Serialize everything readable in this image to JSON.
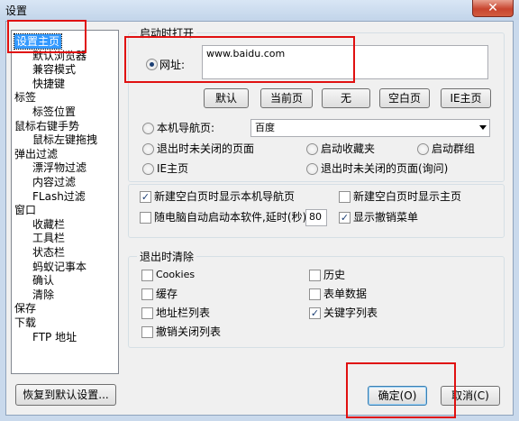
{
  "window": {
    "title": "设置",
    "close_glyph": "✕"
  },
  "tree": [
    {
      "label": "设置主页",
      "level": 0,
      "selected": true
    },
    {
      "label": "默认浏览器",
      "level": 1
    },
    {
      "label": "兼容模式",
      "level": 1
    },
    {
      "label": "快捷键",
      "level": 1
    },
    {
      "label": "标签",
      "level": 0
    },
    {
      "label": "标签位置",
      "level": 1
    },
    {
      "label": "鼠标右键手势",
      "level": 0
    },
    {
      "label": "鼠标左键拖拽",
      "level": 1
    },
    {
      "label": "弹出过滤",
      "level": 0
    },
    {
      "label": "漂浮物过滤",
      "level": 1
    },
    {
      "label": "内容过滤",
      "level": 1
    },
    {
      "label": "FLash过滤",
      "level": 1
    },
    {
      "label": "窗口",
      "level": 0
    },
    {
      "label": "收藏栏",
      "level": 1
    },
    {
      "label": "工具栏",
      "level": 1
    },
    {
      "label": "状态栏",
      "level": 1
    },
    {
      "label": "蚂蚁记事本",
      "level": 1
    },
    {
      "label": "确认",
      "level": 1
    },
    {
      "label": "清除",
      "level": 1
    },
    {
      "label": "保存",
      "level": 0
    },
    {
      "label": "下载",
      "level": 0
    },
    {
      "label": "FTP 地址",
      "level": 1
    }
  ],
  "startup": {
    "group_title": "启动时打开",
    "url_option": "网址:",
    "url_value": "www.baidu.com",
    "buttons": [
      "默认",
      "当前页",
      "无",
      "空白页",
      "IE主页"
    ],
    "local_nav_label": "本机导航页:",
    "local_nav_select": "百度",
    "opt_unclosed": "退出时未关闭的页面",
    "opt_favorites": "启动收藏夹",
    "opt_group": "启动群组",
    "opt_ie_home": "IE主页",
    "opt_unclosed_ask": "退出时未关闭的页面(询问)"
  },
  "options": {
    "new_blank_nav": "新建空白页时显示本机导航页",
    "new_blank_home": "新建空白页时显示主页",
    "autostart": "随电脑自动启动本软件,延时(秒)",
    "autostart_delay": "80",
    "show_undo_menu": "显示撤销菜单"
  },
  "clear": {
    "group_title": "退出时清除",
    "cookies": "Cookies",
    "history": "历史",
    "cache": "缓存",
    "form_data": "表单数据",
    "address_list": "地址栏列表",
    "keyword_list": "关键字列表",
    "undo_close_list": "撤销关闭列表"
  },
  "footer": {
    "restore": "恢复到默认设置...",
    "ok": "确定(O)",
    "cancel": "取消(C)"
  }
}
